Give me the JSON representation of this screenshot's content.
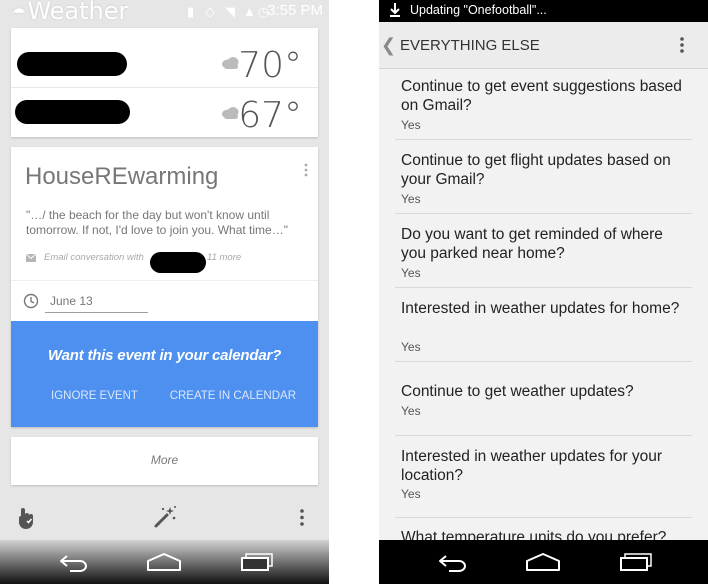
{
  "left_screen": {
    "status_bar": {
      "app_title": "Weather",
      "time": "3:55 PM"
    },
    "weather": {
      "rows": [
        {
          "temperature": "70°",
          "icon": "cloud-icon"
        },
        {
          "temperature": "67°",
          "icon": "cloud-icon"
        }
      ]
    },
    "event_card": {
      "title": "HouseREwarming",
      "snippet": "\"…/ the beach for the day but won't know until tomorrow. If not, I'd love to join you. What time…\"",
      "email_prefix": "Email conversation with",
      "email_suffix": "11 more",
      "date": "June 13",
      "calendar_prompt": "Want this event in your calendar?",
      "ignore_label": "IGNORE EVENT",
      "create_label": "CREATE IN CALENDAR"
    },
    "more_label": "More",
    "toolbar": {
      "icons": [
        "hand-icon",
        "magic-wand-icon",
        "overflow-menu-icon"
      ]
    },
    "nav_icons": [
      "back-icon",
      "home-icon",
      "recents-icon"
    ],
    "colors": {
      "accent": "#4d90f0"
    }
  },
  "right_screen": {
    "status_bar": {
      "text": "Updating \"Onefootball\"..."
    },
    "action_bar": {
      "title": "EVERYTHING ELSE"
    },
    "settings": [
      {
        "question": "Continue to get event suggestions based on Gmail?",
        "value": "Yes"
      },
      {
        "question": "Continue to get flight updates based on your Gmail?",
        "value": "Yes"
      },
      {
        "question": "Do you want to get reminded of where you parked near home?",
        "value": "Yes"
      },
      {
        "question": "Interested in weather updates for home?",
        "value": "Yes"
      },
      {
        "question": "Continue to get weather updates?",
        "value": "Yes"
      },
      {
        "question": "Interested in weather updates for your location?",
        "value": "Yes"
      },
      {
        "question": "What temperature units do you prefer?",
        "value": ""
      }
    ]
  }
}
